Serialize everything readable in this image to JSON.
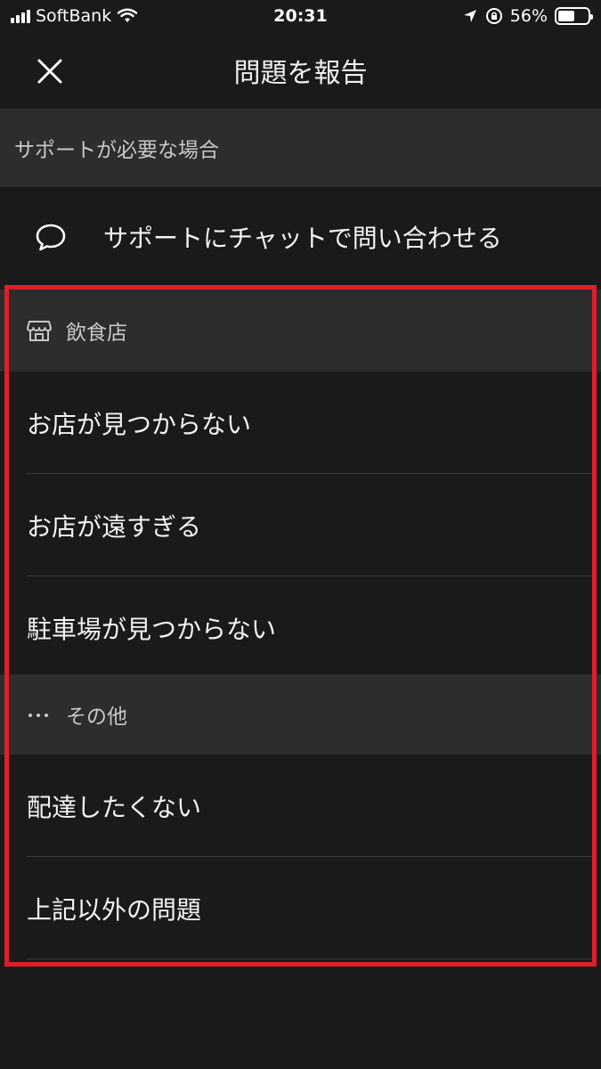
{
  "status_bar": {
    "carrier": "SoftBank",
    "time": "20:31",
    "battery_percent": "56%",
    "battery_level": 0.56
  },
  "nav": {
    "title": "問題を報告"
  },
  "support": {
    "header": "サポートが必要な場合",
    "chat_label": "サポートにチャットで問い合わせる"
  },
  "groups": [
    {
      "header": "飲食店",
      "icon": "store-icon",
      "items": [
        "お店が見つからない",
        "お店が遠すぎる",
        "駐車場が見つからない"
      ]
    },
    {
      "header": "その他",
      "icon": "ellipsis-icon",
      "items": [
        "配達したくない",
        "上記以外の問題"
      ]
    }
  ],
  "colors": {
    "background": "#1a1a1a",
    "section": "#2d2d2d",
    "highlight": "#e01e2b"
  }
}
